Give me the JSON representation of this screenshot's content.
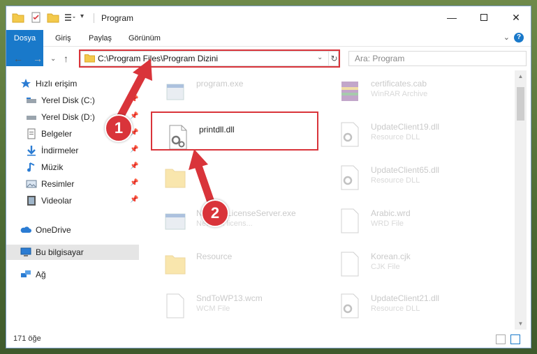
{
  "window": {
    "title": "Program",
    "tabs": [
      "Dosya",
      "Giriş",
      "Paylaş",
      "Görünüm"
    ]
  },
  "address": {
    "path": "C:\\Program Files\\Program Dizini",
    "search_placeholder": "Ara: Program"
  },
  "nav": {
    "items": [
      {
        "label": "Hızlı erişim",
        "icon": "star-icon",
        "pinned": false
      },
      {
        "label": "Yerel Disk (C:)",
        "icon": "drive-icon",
        "pinned": true
      },
      {
        "label": "Yerel Disk (D:)",
        "icon": "drive-icon",
        "pinned": true
      },
      {
        "label": "Belgeler",
        "icon": "documents-icon",
        "pinned": true
      },
      {
        "label": "İndirmeler",
        "icon": "downloads-icon",
        "pinned": true
      },
      {
        "label": "Müzik",
        "icon": "music-icon",
        "pinned": true
      },
      {
        "label": "Resimler",
        "icon": "pictures-icon",
        "pinned": true
      },
      {
        "label": "Videolar",
        "icon": "videos-icon",
        "pinned": true
      },
      {
        "label": "OneDrive",
        "icon": "cloud-icon",
        "pinned": false
      },
      {
        "label": "Bu bilgisayar",
        "icon": "computer-icon",
        "pinned": false
      },
      {
        "label": "Ağ",
        "icon": "network-icon",
        "pinned": false
      }
    ]
  },
  "files": [
    {
      "name": "program.exe",
      "type": ""
    },
    {
      "name": "certificates.cab",
      "type": "WinRAR Archive"
    },
    {
      "name": "printdll.dll",
      "type": ""
    },
    {
      "name": "UpdateClient19.dll",
      "type": "Resource DLL"
    },
    {
      "name": "",
      "type": ""
    },
    {
      "name": "UpdateClient65.dll",
      "type": "Resource DLL"
    },
    {
      "name": "NetworkLicenseServer.exe",
      "type": "Network licens..."
    },
    {
      "name": "Arabic.wrd",
      "type": "WRD File"
    },
    {
      "name": "Resource",
      "type": ""
    },
    {
      "name": "Korean.cjk",
      "type": "CJK File"
    },
    {
      "name": "SndToWP13.wcm",
      "type": "WCM File"
    },
    {
      "name": "UpdateClient21.dll",
      "type": "Resource DLL"
    }
  ],
  "status": {
    "count": "171 öğe"
  },
  "annotations": {
    "step1": "1",
    "step2": "2"
  },
  "colors": {
    "accent": "#1979ca",
    "highlight": "#d9343a"
  }
}
